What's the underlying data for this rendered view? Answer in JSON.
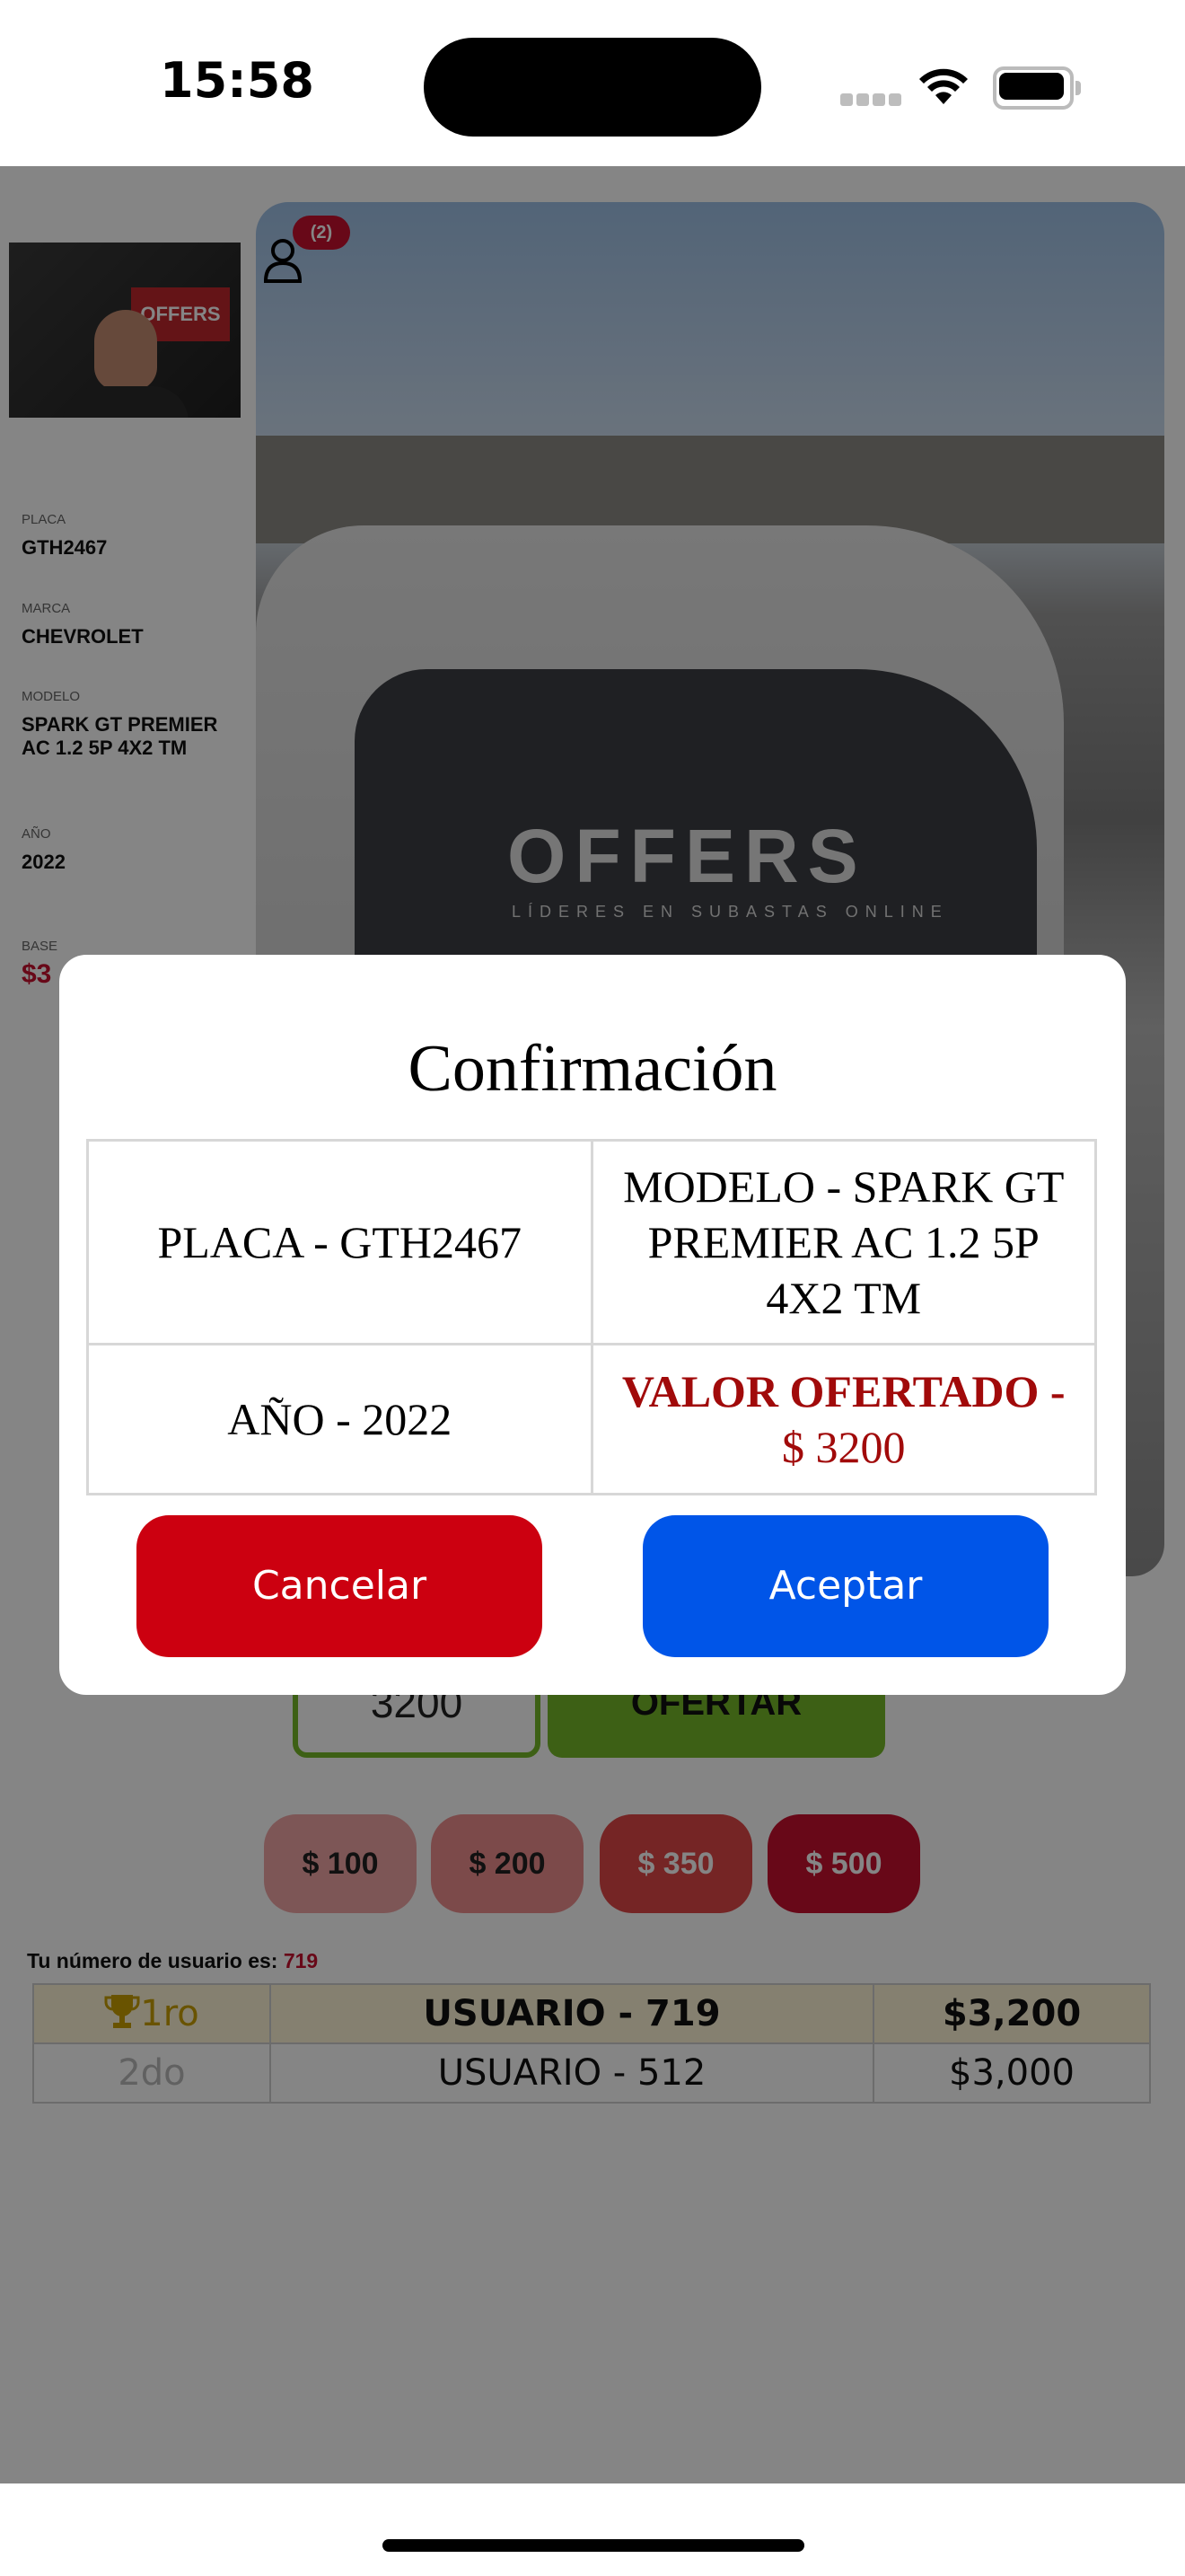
{
  "status_bar": {
    "time": "15:58"
  },
  "vehicle": {
    "placa_label": "PLACA",
    "placa": "GTH2467",
    "marca_label": "MARCA",
    "marca": "CHEVROLET",
    "modelo_label": "MODELO",
    "modelo": "SPARK GT PREMIER AC 1.2 5P 4X2 TM",
    "anio_label": "AÑO",
    "anio": "2022",
    "base_label": "BASE",
    "base_partial": "$3"
  },
  "viewers": {
    "count": "(2)"
  },
  "video": {
    "logo": "OFFERS",
    "tagline": "LÍDERES EN SUBASTAS ONLINE"
  },
  "bid": {
    "value": "3200",
    "ofertar_label": "OFERTAR"
  },
  "increments": [
    "$ 100",
    "$ 200",
    "$ 350",
    "$ 500"
  ],
  "user": {
    "label": "Tu número de usuario es:",
    "number": "719"
  },
  "ranking": [
    {
      "pos": "1ro",
      "user": "USUARIO - 719",
      "amount": "$3,200"
    },
    {
      "pos": "2do",
      "user": "USUARIO - 512",
      "amount": "$3,000"
    }
  ],
  "modal": {
    "title": "Confirmación",
    "placa": "PLACA - GTH2467",
    "modelo": "MODELO - SPARK GT PREMIER AC 1.2 5P 4X2 TM",
    "anio": "AÑO - 2022",
    "valor_label": "VALOR OFERTADO -",
    "valor_amount": "$ 3200",
    "cancel_label": "Cancelar",
    "accept_label": "Aceptar"
  },
  "colors": {
    "accent_red": "#c8102e",
    "accept_blue": "#0055e8",
    "ofertar_green": "#76b82a"
  }
}
